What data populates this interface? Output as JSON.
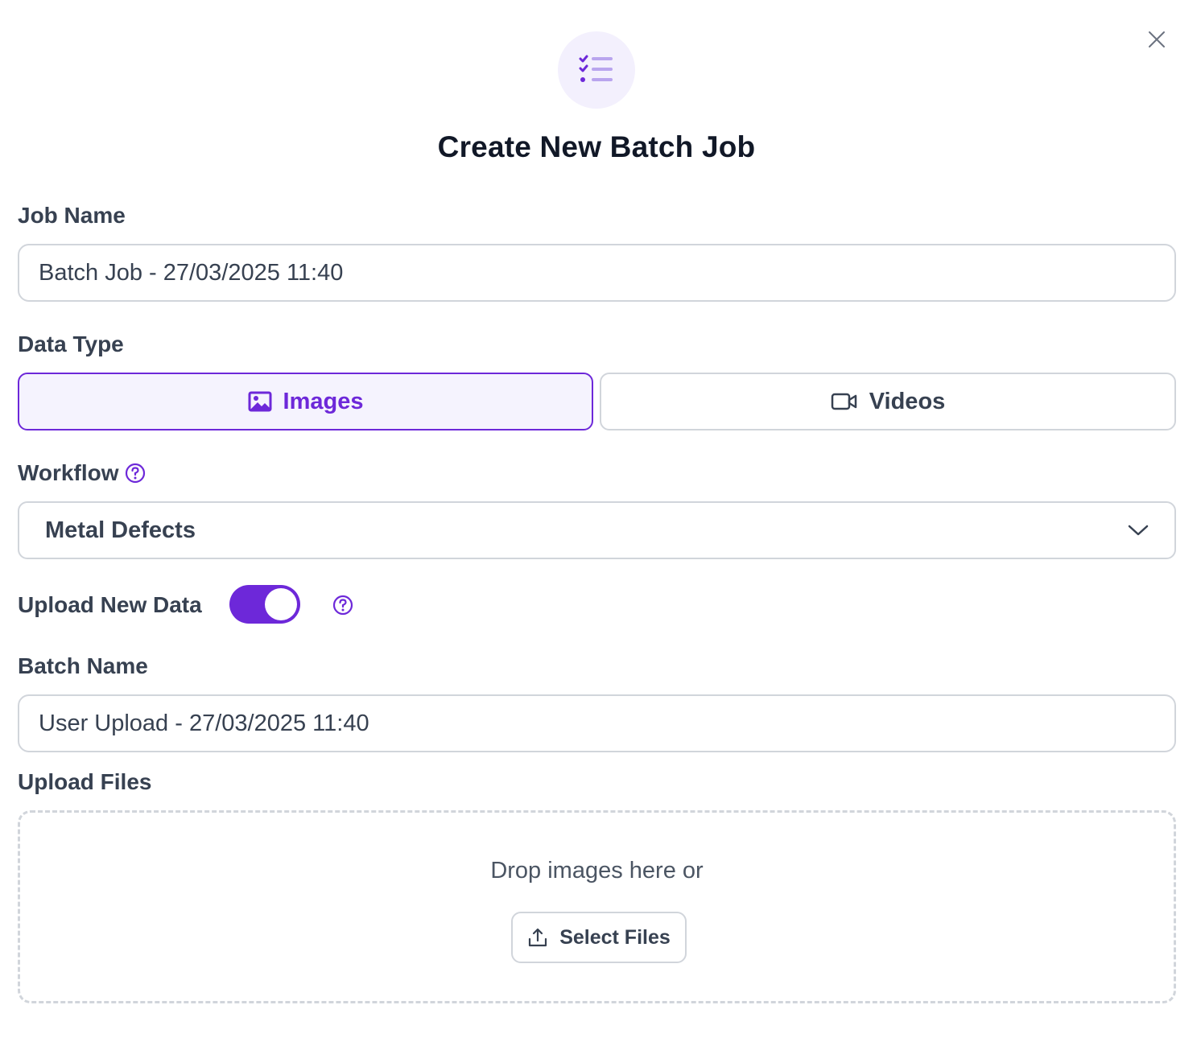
{
  "dialog": {
    "title": "Create New Batch Job",
    "header_icon": "checklist-icon",
    "close_icon": "close-icon"
  },
  "job_name": {
    "label": "Job Name",
    "value": "Batch Job - 27/03/2025 11:40"
  },
  "data_type": {
    "label": "Data Type",
    "options": [
      {
        "label": "Images",
        "icon": "image-icon",
        "selected": true
      },
      {
        "label": "Videos",
        "icon": "video-icon",
        "selected": false
      }
    ]
  },
  "workflow": {
    "label": "Workflow",
    "selected": "Metal Defects",
    "help_icon": "help-icon"
  },
  "upload_new_data": {
    "label": "Upload New Data",
    "enabled": true,
    "help_icon": "help-icon"
  },
  "batch_name": {
    "label": "Batch Name",
    "value": "User Upload - 27/03/2025 11:40"
  },
  "upload_files": {
    "label": "Upload Files",
    "drop_text": "Drop images here or",
    "button_label": "Select Files",
    "button_icon": "upload-icon"
  },
  "colors": {
    "accent": "#6d28d9",
    "accent_bg": "#f5f3fe",
    "border": "#d1d5db",
    "text": "#374151"
  }
}
